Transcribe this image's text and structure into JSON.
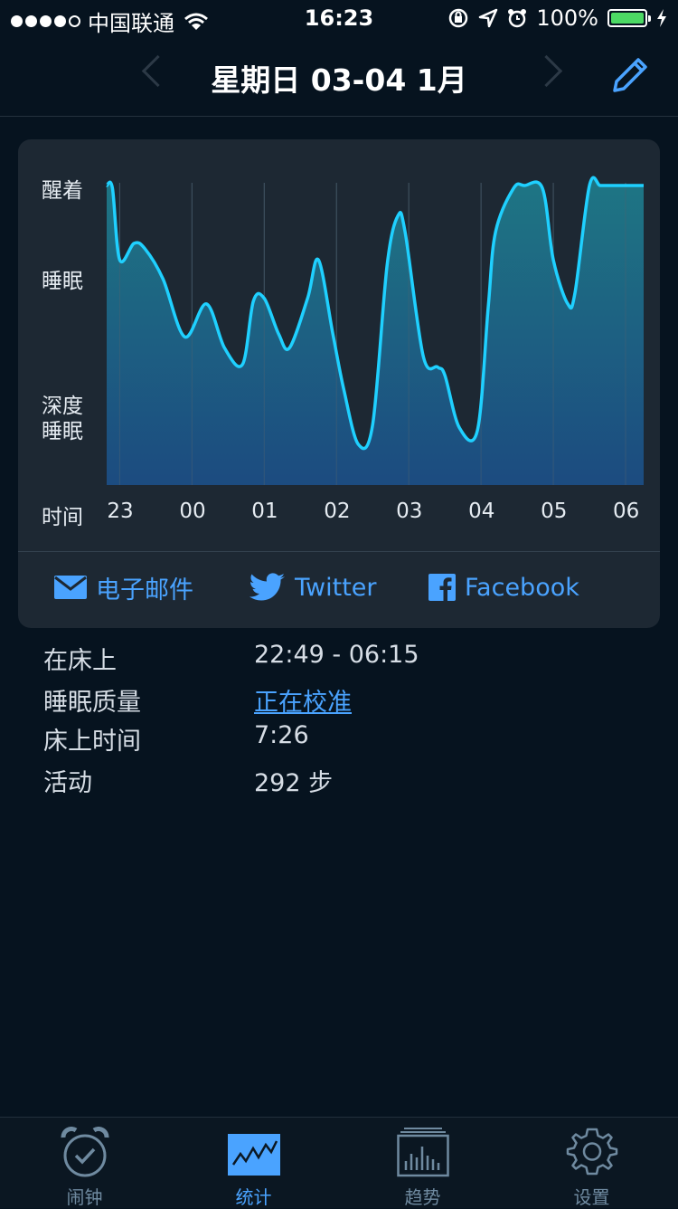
{
  "status_bar": {
    "carrier": "中国联通",
    "time": "16:23",
    "battery": "100%",
    "battery_level": 1.0
  },
  "header": {
    "title": "星期日 03-04 1月"
  },
  "chart_data": {
    "type": "area",
    "y_levels": [
      "醒着",
      "睡眠",
      "深度\n睡眠"
    ],
    "y_labels": {
      "awake": "醒着",
      "sleep": "睡眠",
      "deep_line1": "深度",
      "deep_line2": "睡眠"
    },
    "xlabel": "时间",
    "x_ticks": [
      "23",
      "00",
      "01",
      "02",
      "03",
      "04",
      "05",
      "06"
    ],
    "x_hours": [
      22.82,
      22.9,
      23.0,
      23.2,
      23.35,
      23.6,
      23.9,
      24.2,
      24.45,
      24.7,
      24.85,
      25.0,
      25.2,
      25.35,
      25.6,
      25.75,
      25.95,
      26.1,
      26.3,
      26.5,
      26.7,
      26.85,
      26.95,
      27.2,
      27.4,
      27.5,
      27.7,
      27.95,
      28.1,
      28.2,
      28.45,
      28.6,
      28.85,
      29.0,
      29.2,
      29.3,
      29.5,
      29.65,
      29.8,
      29.95,
      30.15,
      30.25
    ],
    "values": [
      0.99,
      0.98,
      0.72,
      0.78,
      0.76,
      0.65,
      0.44,
      0.56,
      0.4,
      0.34,
      0.57,
      0.58,
      0.45,
      0.4,
      0.58,
      0.72,
      0.45,
      0.25,
      0.05,
      0.12,
      0.7,
      0.88,
      0.82,
      0.37,
      0.33,
      0.3,
      0.11,
      0.1,
      0.55,
      0.82,
      0.98,
      0.99,
      0.98,
      0.72,
      0.56,
      0.6,
      0.99,
      0.99,
      0.99,
      0.99,
      0.99,
      0.99
    ],
    "ylim": [
      0,
      1
    ],
    "color": "#1fd0ff"
  },
  "share": {
    "email": "电子邮件",
    "twitter": "Twitter",
    "facebook": "Facebook"
  },
  "stats": {
    "in_bed_label": "在床上",
    "in_bed_value": "22:49 - 06:15",
    "quality_label": "睡眠质量",
    "quality_value": "正在校准",
    "time_label": "床上时间",
    "time_value": "7:26",
    "activity_label": "活动",
    "activity_value": "292 步"
  },
  "tabs": {
    "alarm": "闹钟",
    "stats": "统计",
    "trends": "趋势",
    "settings": "设置"
  },
  "colors": {
    "accent": "#4aa3ff",
    "background": "#06131f",
    "card": "#1d2833"
  }
}
